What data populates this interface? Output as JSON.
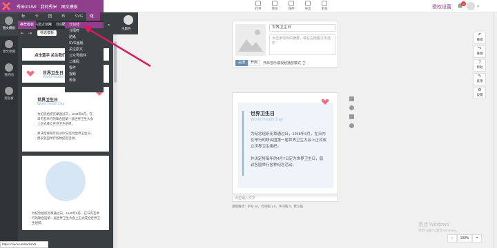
{
  "brand": {
    "name": "秀米XIUMI",
    "links": [
      "我的秀米",
      "图文模板"
    ]
  },
  "toolbar": [
    {
      "icon": "template-icon",
      "label": "打开"
    },
    {
      "icon": "preview-icon",
      "label": "预览"
    },
    {
      "icon": "save-icon",
      "label": "保存"
    },
    {
      "icon": "export-icon",
      "label": "导出"
    },
    {
      "icon": "more-icon",
      "label": "更多"
    }
  ],
  "header": {
    "auth_label": "授权设置",
    "notifications": "3"
  },
  "left_rail": [
    {
      "icon": "graphic-icon",
      "label": "图文模板",
      "active": true
    },
    {
      "icon": "collection-icon",
      "label": "图文收藏"
    },
    {
      "icon": "my-icon",
      "label": "我的图"
    },
    {
      "icon": "layout-icon",
      "label": "剪贴板"
    }
  ],
  "panel": {
    "category_tabs": [
      "标题",
      "卡片",
      "图片",
      "布局",
      "SVG",
      "组件",
      "热门"
    ],
    "active_category": "组件",
    "sub_tabs": [
      "推荐模板",
      "最近使用",
      "我的收藏"
    ],
    "active_sub": "推荐模板",
    "filter_label": "筛选模板"
  },
  "dropdown": {
    "items": [
      "分割线",
      "分隔符",
      "贴纸",
      "SVG画纸",
      "关注原文",
      "公众号组件",
      "二维码",
      "零件",
      "视频",
      "表单"
    ],
    "active_index": 0,
    "avatar_label": "主题色",
    "search_icon": "search-icon"
  },
  "cards": {
    "c1": {
      "title": "点击蓝字 关注我们"
    },
    "c2": {
      "title": "世界卫生日",
      "subtitle": "World Health Day"
    },
    "c3": {
      "title": "世界卫生日",
      "subtitle": "World Health Day",
      "p1": "为纪念组织宪章通过日，1948年6月，在日内瓦举行的联合国第一届世界卫生大会上正式成立世界卫生组织。",
      "p2": "并决定将每年的4月7日定为世界卫生日，倡议各国举行各种纪念活动。"
    },
    "c4": {
      "text": "为纪念组织宪章通过日，1948年6月，在日内瓦举行的联合国第一届世界卫生大会上正式成立世界卫生组织。"
    }
  },
  "editor": {
    "title_value": "世界卫生日",
    "desc_placeholder": "点击添加你的摘要，或在左侧图文中选中",
    "off_label": "关闭",
    "on_label": "开启",
    "mode_label": "开启音乐或视频播放模式"
  },
  "article": {
    "title": "世界卫生日",
    "subtitle": "World Health Day",
    "p1": "为纪念组织宪章通过日，1948年6月，在日内瓦举行的联合国第一届世界卫生大会上正式成立世界卫生组织。",
    "p2": "并决定将每年的4月7日定为世界卫生日，倡议各国举行各种纪念活动。",
    "footer_placeholder": "点击输入文字",
    "status": "基础格式：字号 16，行间距 1.6，字间距 0，默认值"
  },
  "right_tools": [
    {
      "icon": "undo-icon",
      "label": "撤销"
    },
    {
      "icon": "redo-icon",
      "label": "重做"
    },
    {
      "icon": "help-icon",
      "label": "帮助"
    },
    {
      "icon": "feedback-icon",
      "label": "反馈"
    },
    {
      "icon": "settings-icon",
      "label": "设置"
    }
  ],
  "watermark": {
    "line1": "激活 Windows",
    "line2": "转到\"设置\"以激活 Windows。"
  },
  "zoom": {
    "value": "100%"
  },
  "url_tip": "https://xiumi.us/studio/v5",
  "colors": {
    "brand": "#8f3e8b",
    "accent_blue": "#8fb4d6",
    "arrow": "#d81b60"
  }
}
